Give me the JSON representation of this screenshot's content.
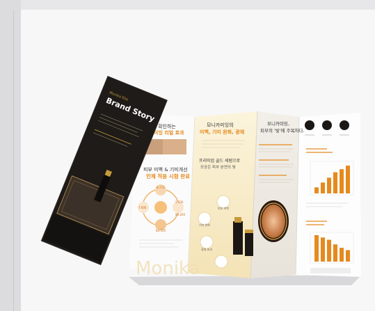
{
  "scene": {
    "cover_title_small": "Monika Elia",
    "cover_title": "Brand Story",
    "panel1_heading_line1": "으로 확인하는",
    "panel1_heading_line2": "LED미잉 리얼 효과",
    "panel1_mid_line1": "피부 미백 & 기미개선",
    "panel1_mid_line2": "인체 적용 시험 완료",
    "panel2_heading_line1": "모니카미잉의",
    "panel2_heading_line2": "미백, 기미 완화, 광채",
    "panel2_mid_line1": "프리미엄 골드 세럼으로",
    "panel2_mid_line2": "모공은 피부 본연의 빛",
    "panel3_heading_line1": "모니카미잉,",
    "panel3_heading_line2": "피부의 '빛'에 주목하다.",
    "watermark_text": "Monika",
    "badge_labels": [
      "피부 미백",
      "기미 완화",
      "광채 효과"
    ],
    "donut_values": [
      "8.773",
      "7.600",
      "2.630",
      "84.200",
      "84.550"
    ],
    "colors": {
      "accent": "#e58a1e",
      "gold": "#c79a3a",
      "dark": "#1e1b18",
      "paper": "#f8f6f2"
    }
  },
  "chart_data": [
    {
      "type": "bar",
      "values": [
        10,
        18,
        26,
        35,
        40,
        46
      ]
    },
    {
      "type": "bar",
      "values": [
        46,
        42,
        38,
        30,
        24,
        20
      ]
    }
  ]
}
